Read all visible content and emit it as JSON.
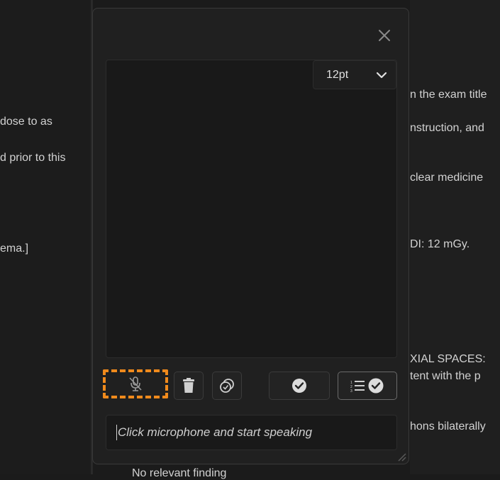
{
  "background_left": [
    "dose to as",
    "d prior to this",
    "ema.]"
  ],
  "background_right": [
    "n the exam title",
    "nstruction, and",
    "clear medicine",
    "DI: 12 mGy.",
    "XIAL SPACES:",
    "tent with the p",
    "hons bilaterally"
  ],
  "background_bottom": "No relevant finding",
  "dialog": {
    "font_size": {
      "selected": "12pt"
    },
    "speech_input": {
      "placeholder": "Click microphone and start speaking"
    }
  },
  "colors": {
    "accent": "#f08a1c",
    "panel": "#202020",
    "editor": "#191919"
  },
  "icons": [
    "close-icon",
    "chevron-down-icon",
    "mic-off-icon",
    "trash-icon",
    "copy-icon",
    "check-circle-icon",
    "list-check-icon",
    "resize-grip-icon"
  ]
}
